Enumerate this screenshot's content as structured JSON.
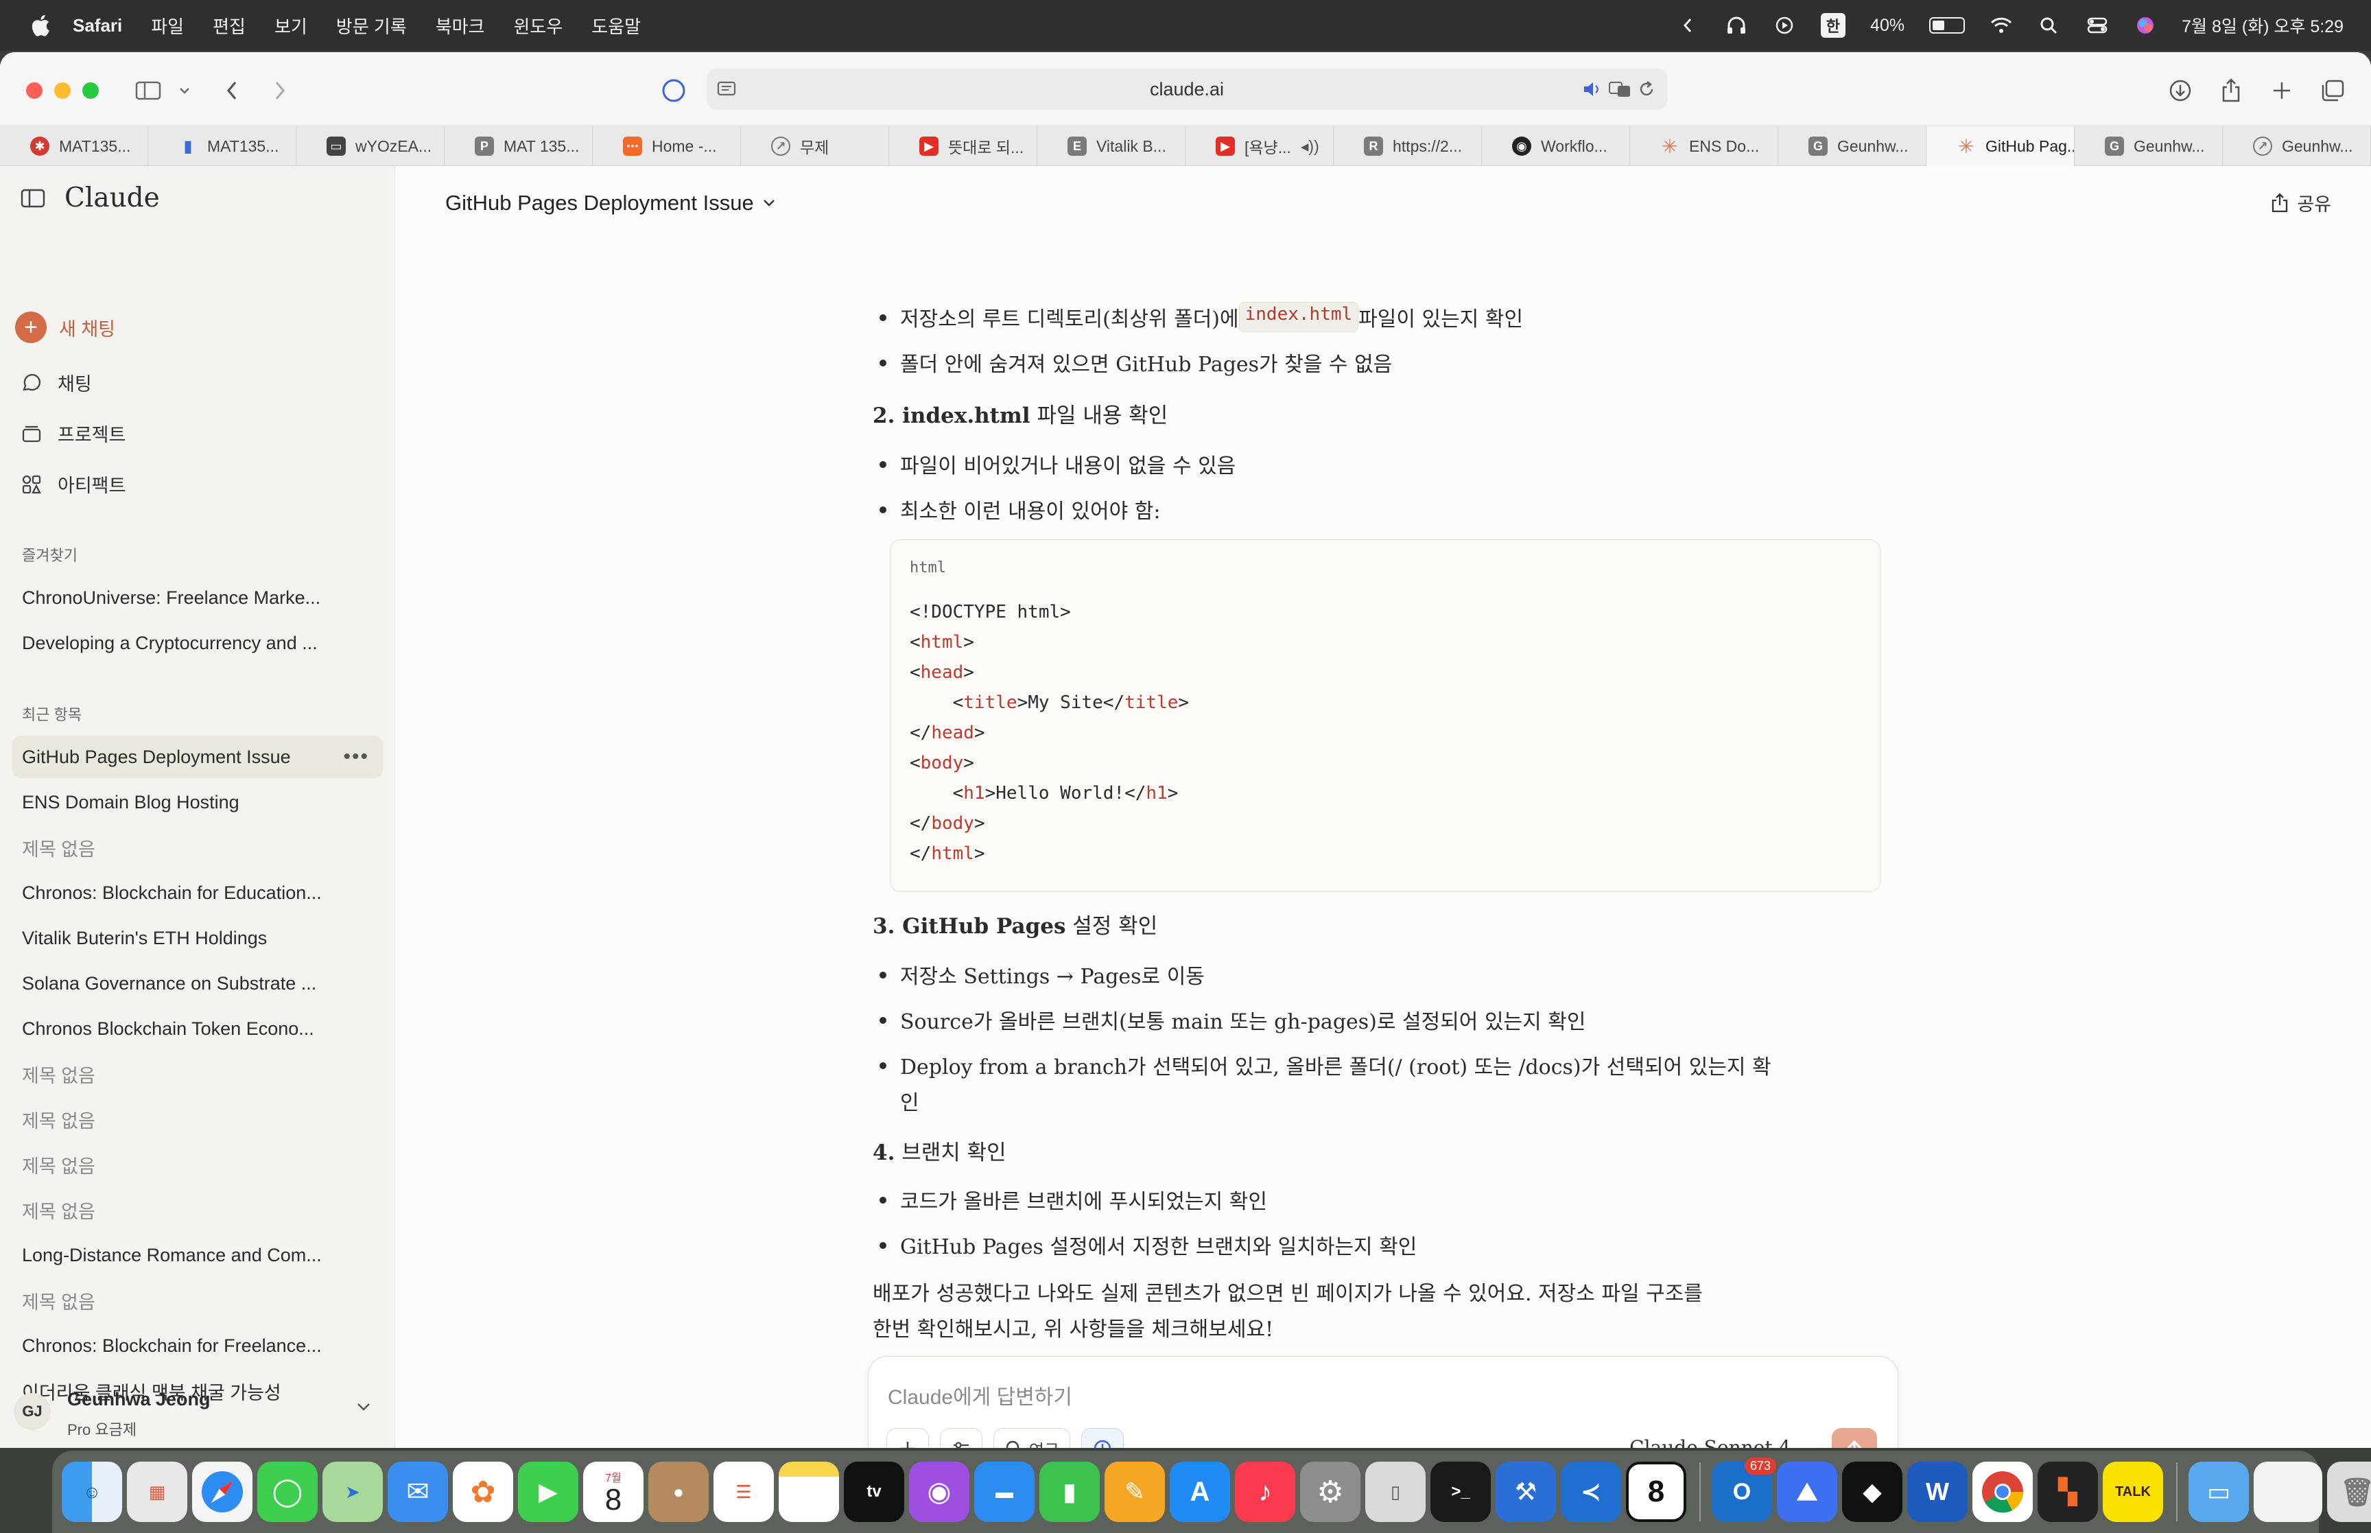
{
  "menubar": {
    "app": "Safari",
    "items": [
      "파일",
      "편집",
      "보기",
      "방문 기록",
      "북마크",
      "윈도우",
      "도움말"
    ],
    "ime": "한",
    "battery": "40%",
    "battery_level": 0.4,
    "datetime": "7월 8일 (화) 오후 5:29"
  },
  "browser": {
    "url": "claude.ai",
    "tabs": [
      {
        "label": "MAT135...",
        "icon": "red-wheel-icon",
        "color": "#d23b2f"
      },
      {
        "label": "MAT135...",
        "icon": "bar-chart-icon",
        "color": "#3a6ad4"
      },
      {
        "label": "wYOzEA...",
        "icon": "presentation-icon",
        "color": "#444444"
      },
      {
        "label": "MAT 135...",
        "icon": "p-icon",
        "color": "#6b6b6b"
      },
      {
        "label": "Home -...",
        "icon": "orange-nodes-icon",
        "color": "#f06a2a"
      },
      {
        "label": "무제",
        "icon": "compass-icon",
        "color": "#777777"
      },
      {
        "label": "뜻대로 되...",
        "icon": "youtube-icon",
        "color": "#e52d27"
      },
      {
        "label": "Vitalik B...",
        "icon": "e-icon",
        "color": "#6b6b6b"
      },
      {
        "label": "[욕냥...",
        "icon": "youtube-icon",
        "color": "#e52d27"
      },
      {
        "label": "https://2...",
        "icon": "r-icon",
        "color": "#6b6b6b"
      },
      {
        "label": "Workflo...",
        "icon": "github-icon",
        "color": "#222222"
      },
      {
        "label": "ENS Do...",
        "icon": "claude-icon",
        "color": "#d97757"
      },
      {
        "label": "Geunhw...",
        "icon": "g-icon",
        "color": "#6b6b6b"
      },
      {
        "label": "GitHub Pag...",
        "icon": "claude-icon",
        "color": "#d97757",
        "active": true
      },
      {
        "label": "Geunhw...",
        "icon": "g-icon",
        "color": "#6b6b6b"
      },
      {
        "label": "Geunhw...",
        "icon": "compass-icon",
        "color": "#777777"
      }
    ]
  },
  "sidebar": {
    "brand": "Claude",
    "new_chat": "새 채팅",
    "nav": [
      "채팅",
      "프로젝트",
      "아티팩트"
    ],
    "favorites_title": "즐겨찾기",
    "favorites": [
      "ChronoUniverse: Freelance Marke...",
      "Developing a Cryptocurrency and ..."
    ],
    "recents_title": "최근 항목",
    "recents": [
      {
        "label": "GitHub Pages Deployment Issue",
        "muted": false,
        "active": true
      },
      {
        "label": "ENS Domain Blog Hosting",
        "muted": false
      },
      {
        "label": "제목 없음",
        "muted": true
      },
      {
        "label": "Chronos: Blockchain for Education...",
        "muted": false
      },
      {
        "label": "Vitalik Buterin's ETH Holdings",
        "muted": false
      },
      {
        "label": "Solana Governance on Substrate ...",
        "muted": false
      },
      {
        "label": "Chronos Blockchain Token Econo...",
        "muted": false
      },
      {
        "label": "제목 없음",
        "muted": true
      },
      {
        "label": "제목 없음",
        "muted": true
      },
      {
        "label": "제목 없음",
        "muted": true
      },
      {
        "label": "제목 없음",
        "muted": true
      },
      {
        "label": "Long-Distance Romance and Com...",
        "muted": false
      },
      {
        "label": "제목 없음",
        "muted": true
      },
      {
        "label": "Chronos: Blockchain for Freelance...",
        "muted": false
      },
      {
        "label": "이더리움 클래식 맥북 채굴 가능성",
        "muted": false
      }
    ],
    "user": {
      "initials": "GJ",
      "name": "Geunhwa Jeong",
      "plan": "Pro 요금제"
    }
  },
  "chat": {
    "title": "GitHub Pages Deployment Issue",
    "share": "공유",
    "b1_pre": "저장소의 루트 디렉토리(최상위 폴더)에 ",
    "b1_code": "index.html",
    "b1_post": " 파일이 있는지 확인",
    "b2": "폴더 안에 숨겨져 있으면 GitHub Pages가 찾을 수 없음",
    "h2_bold": "2. index.html",
    "h2_rest": " 파일 내용 확인",
    "b3": "파일이 비어있거나 내용이 없을 수 있음",
    "b4": "최소한 이런 내용이 있어야 함:",
    "code_lang": "html",
    "h3_bold": "3. GitHub Pages",
    "h3_rest": " 설정 확인",
    "b5": "저장소 Settings → Pages로 이동",
    "b6": "Source가 올바른 브랜치(보통 main 또는 gh-pages)로 설정되어 있는지 확인",
    "b7_line1": "Deploy from a branch가 선택되어 있고, 올바른 폴더(/ (root) 또는 /docs)가 선택되어 있는지 확",
    "b7_line2": "인",
    "h4_bold": "4.",
    "h4_rest": " 브랜치 확인",
    "b8": "코드가 올바른 브랜치에 푸시되었는지 확인",
    "b9": "GitHub Pages 설정에서 지정한 브랜치와 일치하는지 확인",
    "p_line1": "배포가 성공했다고 나와도 실제 콘텐츠가 없으면 빈 페이지가 나올 수 있어요. 저장소 파일 구조를",
    "p_line2": "한번 확인해보시고, 위 사항들을 체크해보세요!"
  },
  "composer": {
    "placeholder": "Claude에게 답변하기",
    "research": "연구",
    "model": "Claude Sonnet 4"
  },
  "dock": {
    "calendar_month": "7월",
    "calendar_day": "8",
    "outlook_badge": "673",
    "apps": [
      "Finder",
      "Launchpad",
      "Safari",
      "Messages",
      "Maps",
      "Mail",
      "Photos",
      "FaceTime",
      "Calendar",
      "Contacts",
      "Reminders",
      "Notes",
      "TV",
      "Podcasts",
      "Keynote",
      "Numbers",
      "Pages",
      "App Store",
      "Music",
      "System Settings",
      "iPhone Mirroring",
      "Terminal",
      "Xcode",
      "VS Code",
      "Calendar 8",
      "Outlook",
      "NordVPN",
      "Unity",
      "Word",
      "Chrome",
      "Office",
      "KakaoTalk",
      "Folder",
      "Downloads",
      "Trash"
    ]
  }
}
